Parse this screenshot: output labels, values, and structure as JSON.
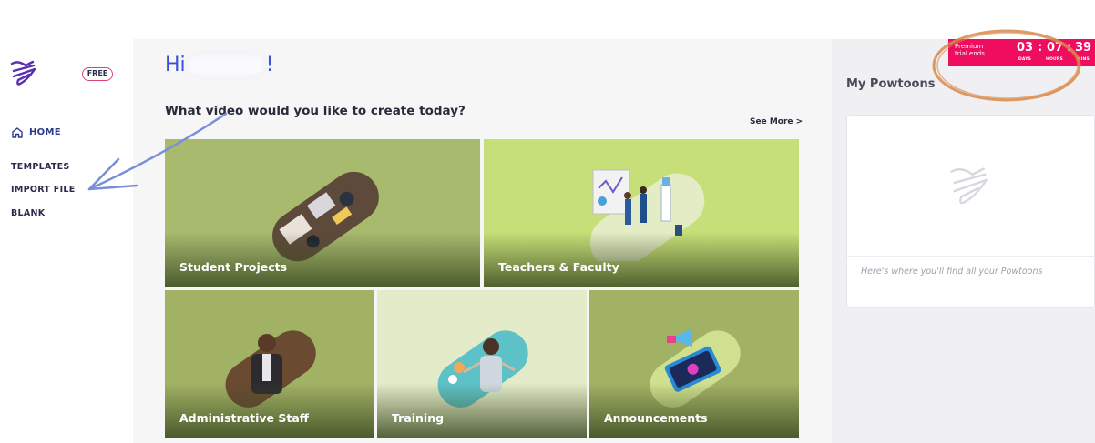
{
  "sidebar": {
    "badge": "FREE",
    "home": "HOME",
    "items": [
      "TEMPLATES",
      "IMPORT FILE",
      "BLANK"
    ]
  },
  "main": {
    "greeting_prefix": "Hi",
    "greeting_suffix": "!",
    "question": "What video would you like to create today?",
    "see_more": "See More >",
    "cards": [
      {
        "label": "Student Projects"
      },
      {
        "label": "Teachers & Faculty"
      },
      {
        "label": "Administrative Staff"
      },
      {
        "label": "Training"
      },
      {
        "label": "Announcements"
      }
    ]
  },
  "right": {
    "title": "My Powtoons",
    "empty_text": "Here's where you'll find all your Powtoons"
  },
  "trial": {
    "text_line1": "Premium",
    "text_line2": "trial ends",
    "days": "03",
    "hours": "07",
    "mins": "39",
    "days_label": "DAYS",
    "hours_label": "HOURS",
    "mins_label": "MINS"
  },
  "colors": {
    "accent": "#3a50d9",
    "trial": "#ee0d5e",
    "card_green": "#a2b46a",
    "card_lime": "#c6de76",
    "card_pale": "#e4ecc9",
    "annotation_orange": "#d98a4a",
    "annotation_blue": "#7a8fd8"
  },
  "icons": {
    "logo": "powtoon-logo-icon",
    "home": "home-icon"
  }
}
